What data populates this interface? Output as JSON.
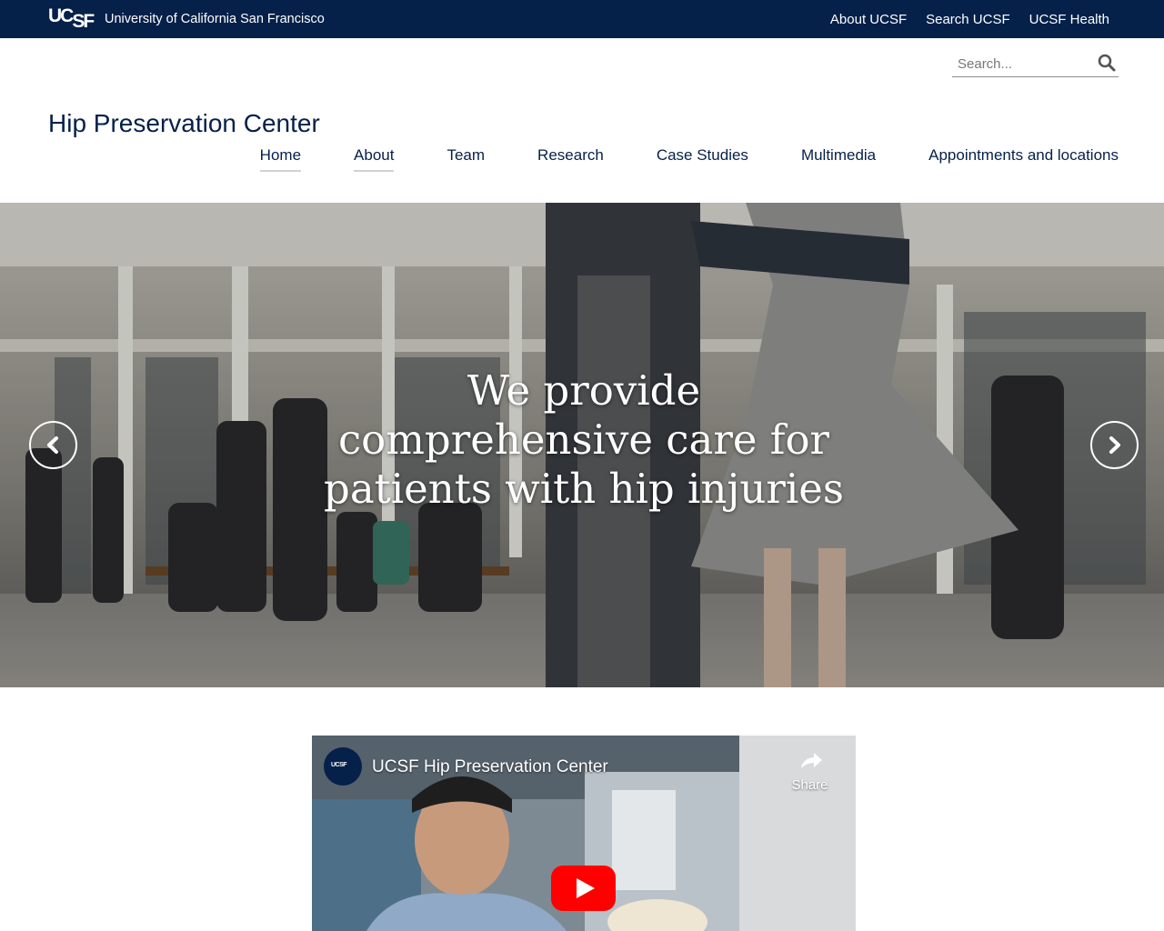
{
  "topbar": {
    "logo_uc": "UC",
    "logo_sf": "SF",
    "university": "University of California San Francisco",
    "links": [
      "About UCSF",
      "Search UCSF",
      "UCSF Health"
    ]
  },
  "search": {
    "placeholder": "Search...",
    "value": "",
    "icon": "magnifier-icon"
  },
  "site": {
    "title": "Hip Preservation Center"
  },
  "nav": {
    "items": [
      "Home",
      "About",
      "Team",
      "Research",
      "Case Studies",
      "Multimedia",
      "Appointments and locations"
    ],
    "active": "Home"
  },
  "hero": {
    "caption": "We provide comprehensive care for patients with hip injuries",
    "prev_icon": "chevron-left-icon",
    "next_icon": "chevron-right-icon"
  },
  "video": {
    "title": "UCSF Hip Preservation Center",
    "share_label": "Share",
    "play_icon": "youtube-play-icon",
    "channel_logo": "UCSF"
  },
  "colors": {
    "navy": "#052049",
    "white": "#ffffff",
    "youtube_red": "#ff0000"
  }
}
